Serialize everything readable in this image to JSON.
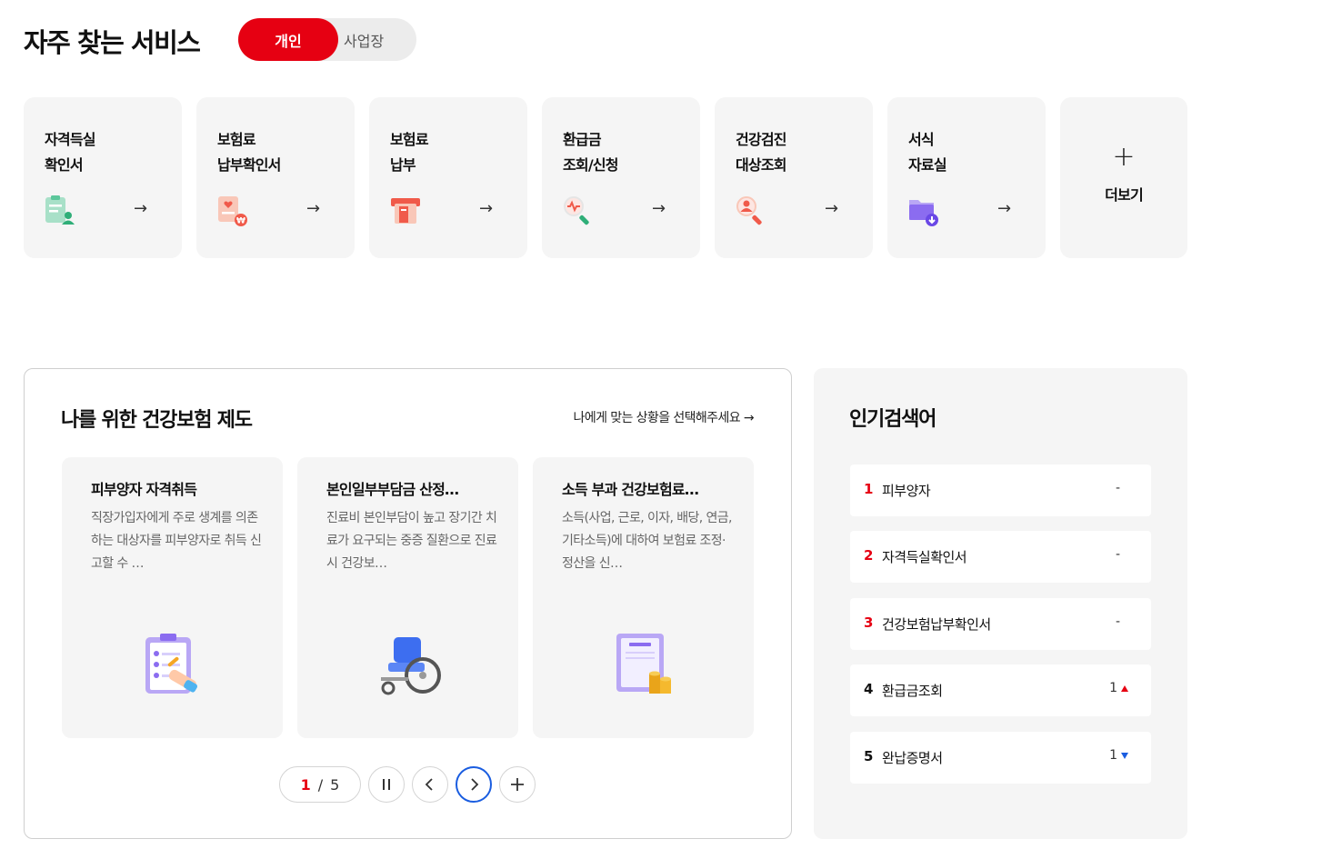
{
  "header": {
    "title": "자주 찾는 서비스",
    "toggle": {
      "active": "개인",
      "inactive": "사업장"
    }
  },
  "services": [
    {
      "line1": "자격득실",
      "line2": "확인서",
      "icon": "clipboard-person-icon"
    },
    {
      "line1": "보험료",
      "line2": "납부확인서",
      "icon": "document-won-icon"
    },
    {
      "line1": "보험료",
      "line2": "납부",
      "icon": "payment-machine-icon"
    },
    {
      "line1": "환급금",
      "line2": "조회/신청",
      "icon": "magnifier-heartbeat-icon"
    },
    {
      "line1": "건강검진",
      "line2": "대상조회",
      "icon": "magnifier-person-icon"
    },
    {
      "line1": "서식",
      "line2": "자료실",
      "icon": "folder-download-icon"
    }
  ],
  "service_arrow": "→",
  "more": {
    "plus": "+",
    "label": "더보기"
  },
  "insurance": {
    "title": "나를 위한 건강보험 제도",
    "link": "나에게 맞는 상황을 선택해주세요 →",
    "cards": [
      {
        "title": "피부양자 자격취득",
        "desc": "직장가입자에게 주로 생계를 의존하는 대상자를 피부양자로 취득 신고할 수 …",
        "icon": "clipboard-checklist-icon"
      },
      {
        "title": "본인일부부담금 산정…",
        "desc": "진료비 본인부담이 높고 장기간 치료가 요구되는 중증 질환으로 진료 시 건강보…",
        "icon": "wheelchair-icon"
      },
      {
        "title": "소득 부과 건강보험료…",
        "desc": "소득(사업, 근로, 이자, 배당, 연금, 기타소득)에 대하여 보험료 조정·정산을 신…",
        "icon": "document-coins-icon"
      }
    ],
    "pager": {
      "current": "1",
      "separator": "/",
      "total": "5"
    }
  },
  "popular": {
    "title": "인기검색어",
    "items": [
      {
        "rank": "1",
        "keyword": "피부양자",
        "change": "-",
        "trend": "none"
      },
      {
        "rank": "2",
        "keyword": "자격득실확인서",
        "change": "-",
        "trend": "none"
      },
      {
        "rank": "3",
        "keyword": "건강보험납부확인서",
        "change": "-",
        "trend": "none"
      },
      {
        "rank": "4",
        "keyword": "환급금조회",
        "change": "1",
        "trend": "up"
      },
      {
        "rank": "5",
        "keyword": "완납증명서",
        "change": "1",
        "trend": "down"
      }
    ]
  },
  "colors": {
    "accent": "#e60012",
    "focus": "#1a5de0",
    "card_bg": "#f5f5f5"
  }
}
